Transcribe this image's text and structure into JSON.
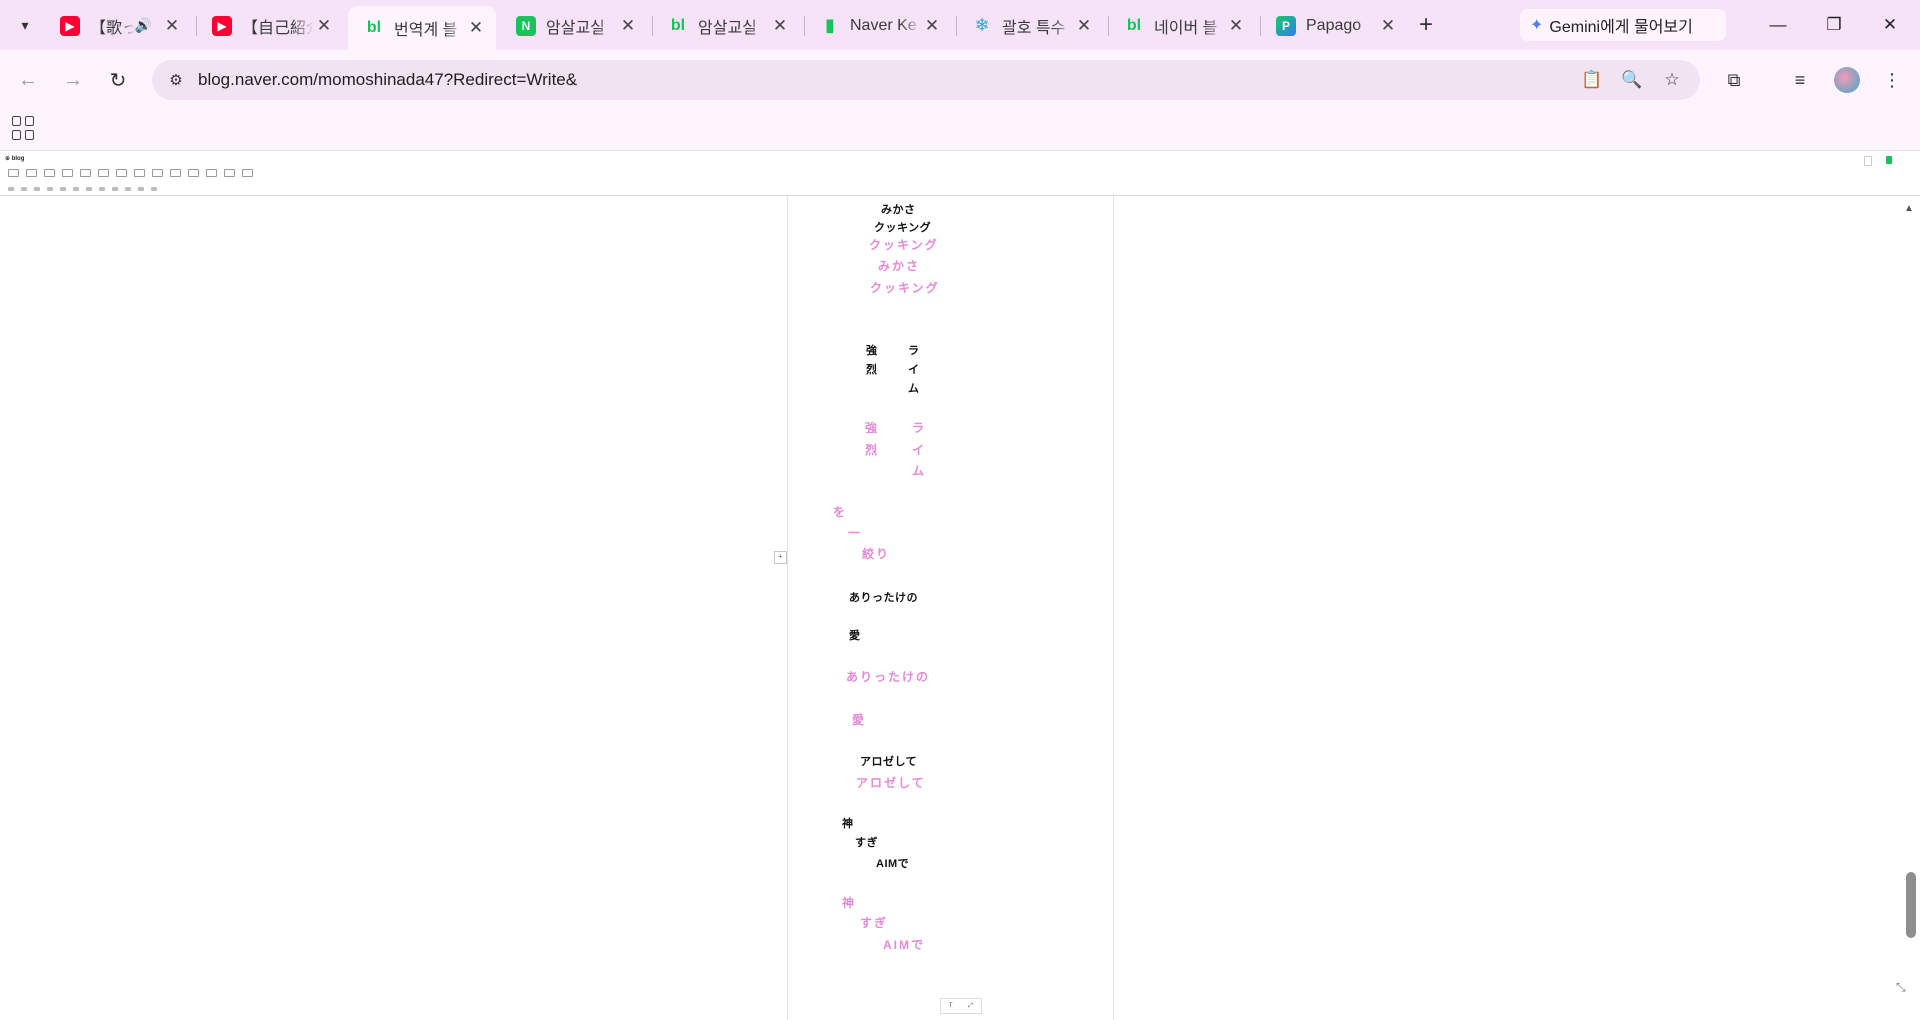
{
  "tabs": [
    {
      "title": "【歌っ",
      "favicon": "youtube-icon",
      "audio": true,
      "active": false
    },
    {
      "title": "【自己紹介",
      "favicon": "youtube-icon",
      "audio": false,
      "active": false
    },
    {
      "title": "번역계 블",
      "favicon": "naver-blog-icon",
      "audio": false,
      "active": true
    },
    {
      "title": "암살교실",
      "favicon": "naver-icon",
      "audio": false,
      "active": false
    },
    {
      "title": "암살교실",
      "favicon": "naver-blog-icon",
      "audio": false,
      "active": false
    },
    {
      "title": "Naver Ke",
      "favicon": "bookmark-icon",
      "audio": false,
      "active": false
    },
    {
      "title": "괄호 특수",
      "favicon": "snowflake-icon",
      "audio": false,
      "active": false
    },
    {
      "title": "네이버 블",
      "favicon": "naver-blog-icon",
      "audio": false,
      "active": false
    },
    {
      "title": "Papago",
      "favicon": "papago-icon",
      "audio": false,
      "active": false
    }
  ],
  "gemini_label": "Gemini에게 물어보기",
  "url": "blog.naver.com/momoshinada47?Redirect=Write&",
  "editor": {
    "logo": "blog"
  },
  "lyrics": [
    {
      "text": "みかさ",
      "style": "k"
    },
    {
      "text": "クッキング",
      "style": "k"
    },
    {
      "text": "クッキング",
      "style": "p"
    },
    {
      "text": "みかさ",
      "style": "p"
    },
    {
      "text": "クッキング",
      "style": "p"
    },
    {
      "text": "強",
      "style": "k"
    },
    {
      "text": "ラ",
      "style": "k"
    },
    {
      "text": "烈",
      "style": "k"
    },
    {
      "text": "イ",
      "style": "k"
    },
    {
      "text": "ム",
      "style": "k"
    },
    {
      "text": "強",
      "style": "p"
    },
    {
      "text": "ラ",
      "style": "p"
    },
    {
      "text": "烈",
      "style": "p"
    },
    {
      "text": "イ",
      "style": "p"
    },
    {
      "text": "ム",
      "style": "p"
    },
    {
      "text": "を",
      "style": "p"
    },
    {
      "text": "一",
      "style": "p"
    },
    {
      "text": "絞り",
      "style": "p"
    },
    {
      "text": "ありったけの",
      "style": "k"
    },
    {
      "text": "愛",
      "style": "k"
    },
    {
      "text": "ありったけの",
      "style": "p"
    },
    {
      "text": "愛",
      "style": "p"
    },
    {
      "text": "アロゼして",
      "style": "k"
    },
    {
      "text": "アロゼして",
      "style": "p"
    },
    {
      "text": "神",
      "style": "k"
    },
    {
      "text": "すぎ",
      "style": "k"
    },
    {
      "text": "AIMで",
      "style": "k"
    },
    {
      "text": "神",
      "style": "p"
    },
    {
      "text": "すぎ",
      "style": "p"
    },
    {
      "text": "AIMで",
      "style": "p"
    }
  ],
  "colors": {
    "tabbar": "#f6e3f8",
    "toolbar": "#fdf4fd",
    "lyric_pink": "#e48ad6",
    "publish_green": "#19c35a"
  }
}
